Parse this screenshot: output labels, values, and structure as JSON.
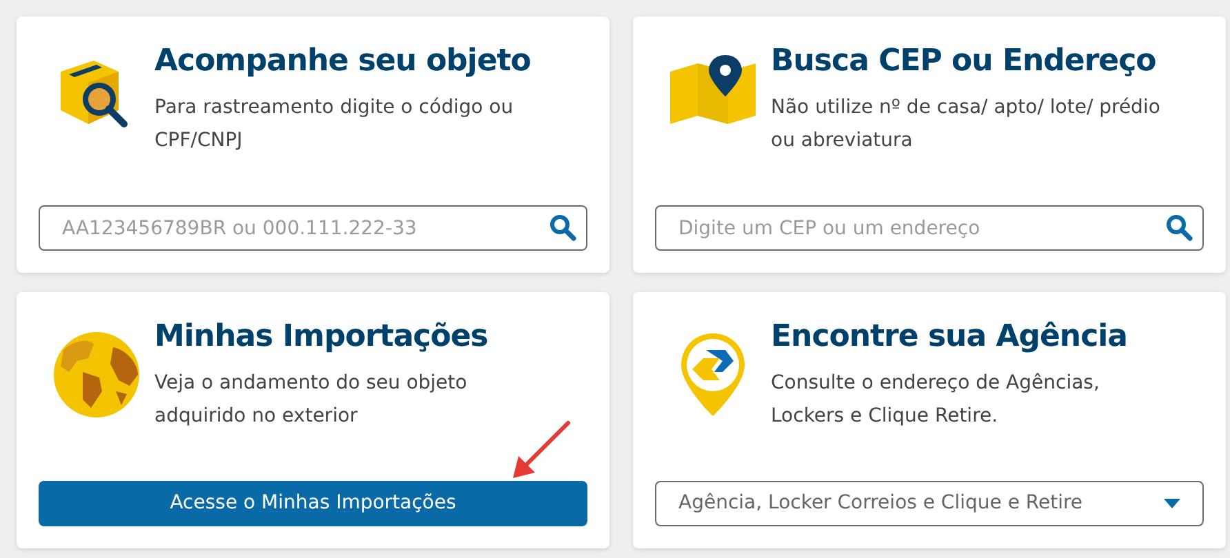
{
  "cards": [
    {
      "title": "Acompanhe seu objeto",
      "description": "Para rastreamento digite o código ou CPF/CNPJ",
      "control": {
        "kind": "search",
        "placeholder": "AA123456789BR ou 000.111.222-33"
      }
    },
    {
      "title": "Busca CEP ou Endereço",
      "description": "Não utilize nº de casa/ apto/ lote/ prédio ou abreviatura",
      "control": {
        "kind": "search",
        "placeholder": "Digite um CEP ou um endereço"
      }
    },
    {
      "title": "Minhas Importações",
      "description": "Veja o andamento do seu objeto adquirido no exterior",
      "control": {
        "kind": "button",
        "label": "Acesse o Minhas Importações"
      }
    },
    {
      "title": "Encontre sua Agência",
      "description": "Consulte o endereço de Agências, Lockers e Clique Retire.",
      "control": {
        "kind": "select",
        "value": "Agência, Locker Correios e Clique e Retire"
      }
    }
  ]
}
